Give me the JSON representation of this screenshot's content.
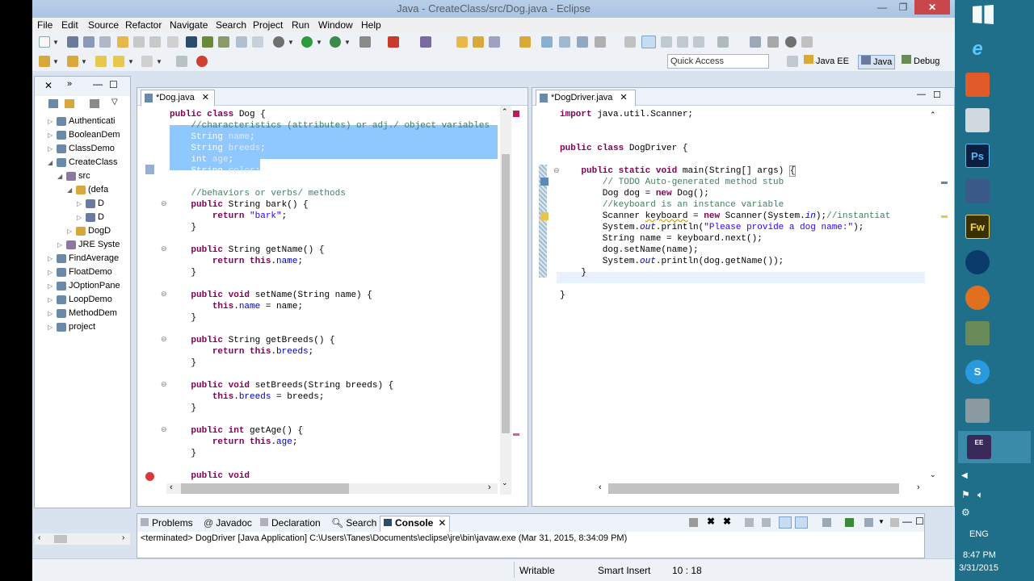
{
  "window": {
    "title": "Java - CreateClass/src/Dog.java - Eclipse"
  },
  "menu": [
    "File",
    "Edit",
    "Source",
    "Refactor",
    "Navigate",
    "Search",
    "Project",
    "Run",
    "Window",
    "Help"
  ],
  "quick_access": {
    "placeholder": "Quick Access"
  },
  "perspectives": [
    "Java EE",
    "Java",
    "Debug"
  ],
  "package_explorer": {
    "items": [
      {
        "label": "Authenticati",
        "depth": 0,
        "twisty": "▷"
      },
      {
        "label": "BooleanDem",
        "depth": 0,
        "twisty": "▷"
      },
      {
        "label": "ClassDemo",
        "depth": 0,
        "twisty": "▷"
      },
      {
        "label": "CreateClass",
        "depth": 0,
        "twisty": "◢"
      },
      {
        "label": "src",
        "depth": 1,
        "twisty": "◢"
      },
      {
        "label": "(defa",
        "depth": 2,
        "twisty": "◢"
      },
      {
        "label": "D",
        "depth": 3,
        "twisty": "▷"
      },
      {
        "label": "D",
        "depth": 3,
        "twisty": "▷"
      },
      {
        "label": "DogD",
        "depth": 2,
        "twisty": "▷"
      },
      {
        "label": "JRE Syste",
        "depth": 1,
        "twisty": "▷"
      },
      {
        "label": "FindAverage",
        "depth": 0,
        "twisty": "▷"
      },
      {
        "label": "FloatDemo",
        "depth": 0,
        "twisty": "▷"
      },
      {
        "label": "JOptionPane",
        "depth": 0,
        "twisty": "▷"
      },
      {
        "label": "LoopDemo",
        "depth": 0,
        "twisty": "▷"
      },
      {
        "label": "MethodDem",
        "depth": 0,
        "twisty": "▷"
      },
      {
        "label": "project",
        "depth": 0,
        "twisty": "▷"
      }
    ]
  },
  "editor_left": {
    "tab": "*Dog.java"
  },
  "editor_right": {
    "tab": "*DogDriver.java"
  },
  "bottom_panel": {
    "tabs": [
      "Problems",
      "Javadoc",
      "Declaration",
      "Search",
      "Console"
    ],
    "console_line": "<terminated> DogDriver [Java Application] C:\\Users\\Tanes\\Documents\\eclipse\\jre\\bin\\javaw.exe (Mar 31, 2015, 8:34:09 PM)"
  },
  "status": {
    "writable": "Writable",
    "insert": "Smart Insert",
    "position": "10 : 18"
  },
  "taskbar": {
    "lang": "ENG",
    "time": "8:47 PM",
    "date": "3/31/2015"
  }
}
